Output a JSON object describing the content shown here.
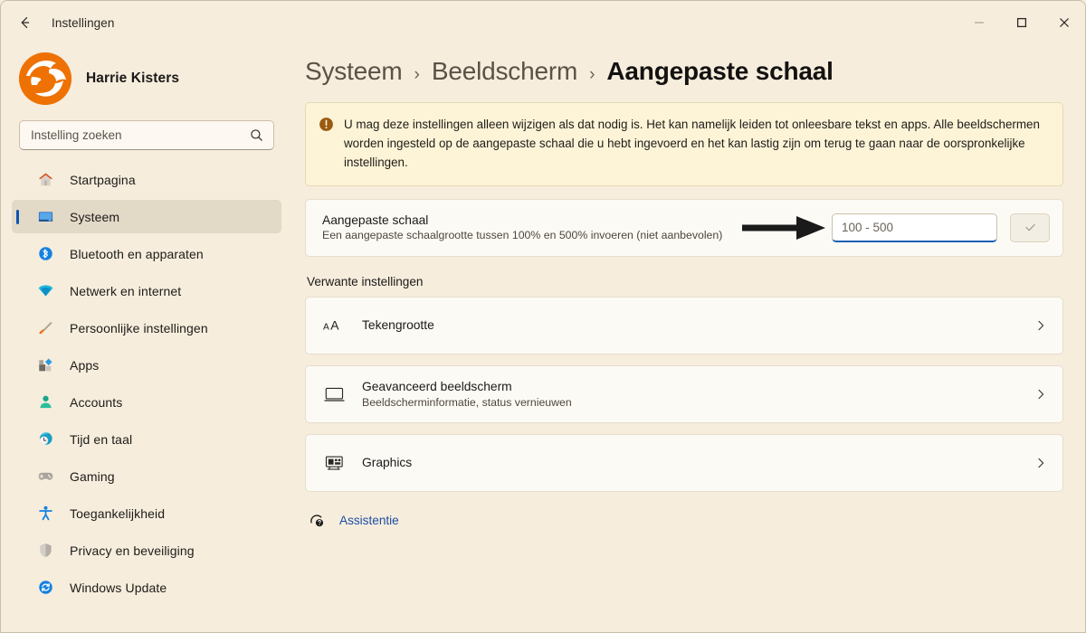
{
  "window": {
    "app_title": "Instellingen",
    "back_icon": "back-arrow-icon",
    "minimize_label": "─",
    "maximize_label": "□",
    "close_label": "✕"
  },
  "sidebar": {
    "profile": {
      "name": "Harrie Kisters",
      "avatar_icon": "user-avatar-logo"
    },
    "search": {
      "placeholder": "Instelling zoeken",
      "value": "",
      "icon": "search-icon"
    },
    "items": [
      {
        "label": "Startpagina",
        "icon": "home-icon",
        "active": false
      },
      {
        "label": "Systeem",
        "icon": "monitor-icon",
        "active": true
      },
      {
        "label": "Bluetooth en apparaten",
        "icon": "bluetooth-icon",
        "active": false
      },
      {
        "label": "Netwerk en internet",
        "icon": "wifi-icon",
        "active": false
      },
      {
        "label": "Persoonlijke instellingen",
        "icon": "paintbrush-icon",
        "active": false
      },
      {
        "label": "Apps",
        "icon": "apps-icon",
        "active": false
      },
      {
        "label": "Accounts",
        "icon": "person-icon",
        "active": false
      },
      {
        "label": "Tijd en taal",
        "icon": "clock-globe-icon",
        "active": false
      },
      {
        "label": "Gaming",
        "icon": "gamepad-icon",
        "active": false
      },
      {
        "label": "Toegankelijkheid",
        "icon": "accessibility-icon",
        "active": false
      },
      {
        "label": "Privacy en beveiliging",
        "icon": "shield-icon",
        "active": false
      },
      {
        "label": "Windows Update",
        "icon": "update-refresh-icon",
        "active": false
      }
    ]
  },
  "main": {
    "breadcrumb": [
      {
        "label": "Systeem",
        "current": false
      },
      {
        "label": "Beeldscherm",
        "current": false
      },
      {
        "label": "Aangepaste schaal",
        "current": true
      }
    ],
    "breadcrumb_separator": "›",
    "warning_banner": {
      "icon": "warning-exclamation-icon",
      "text": "U mag deze instellingen alleen wijzigen als dat nodig is. Het kan namelijk leiden tot onleesbare tekst en apps. Alle beeldschermen worden ingesteld op de aangepaste schaal die u hebt ingevoerd en het kan lastig zijn om terug te gaan naar de oorspronkelijke instellingen."
    },
    "custom_scale": {
      "title": "Aangepaste schaal",
      "subtitle": "Een aangepaste schaalgrootte tussen 100% en 500% invoeren (niet aanbevolen)",
      "input_placeholder": "100 - 500",
      "input_value": "",
      "confirm_icon": "checkmark-icon",
      "annotation_icon": "pointing-arrow-annotation"
    },
    "related_settings_label": "Verwante instellingen",
    "related_items": [
      {
        "title": "Tekengrootte",
        "subtitle": "",
        "icon": "font-size-aa-icon",
        "chevron": "chevron-right-icon"
      },
      {
        "title": "Geavanceerd beeldscherm",
        "subtitle": "Beeldscherminformatie, status vernieuwen",
        "icon": "display-monitor-icon",
        "chevron": "chevron-right-icon"
      },
      {
        "title": "Graphics",
        "subtitle": "",
        "icon": "graphics-card-icon",
        "chevron": "chevron-right-icon"
      }
    ],
    "help_link": {
      "label": "Assistentie",
      "icon": "help-question-icon"
    }
  },
  "colors": {
    "page_background": "#f6eddd",
    "card_background": "#fcfaf5",
    "warning_background": "#fdf4d8",
    "accent_blue": "#1a5fb4",
    "link_blue": "#1d4fa3",
    "avatar_orange": "#ee7203",
    "selection_indicator": "#0f54b0"
  }
}
